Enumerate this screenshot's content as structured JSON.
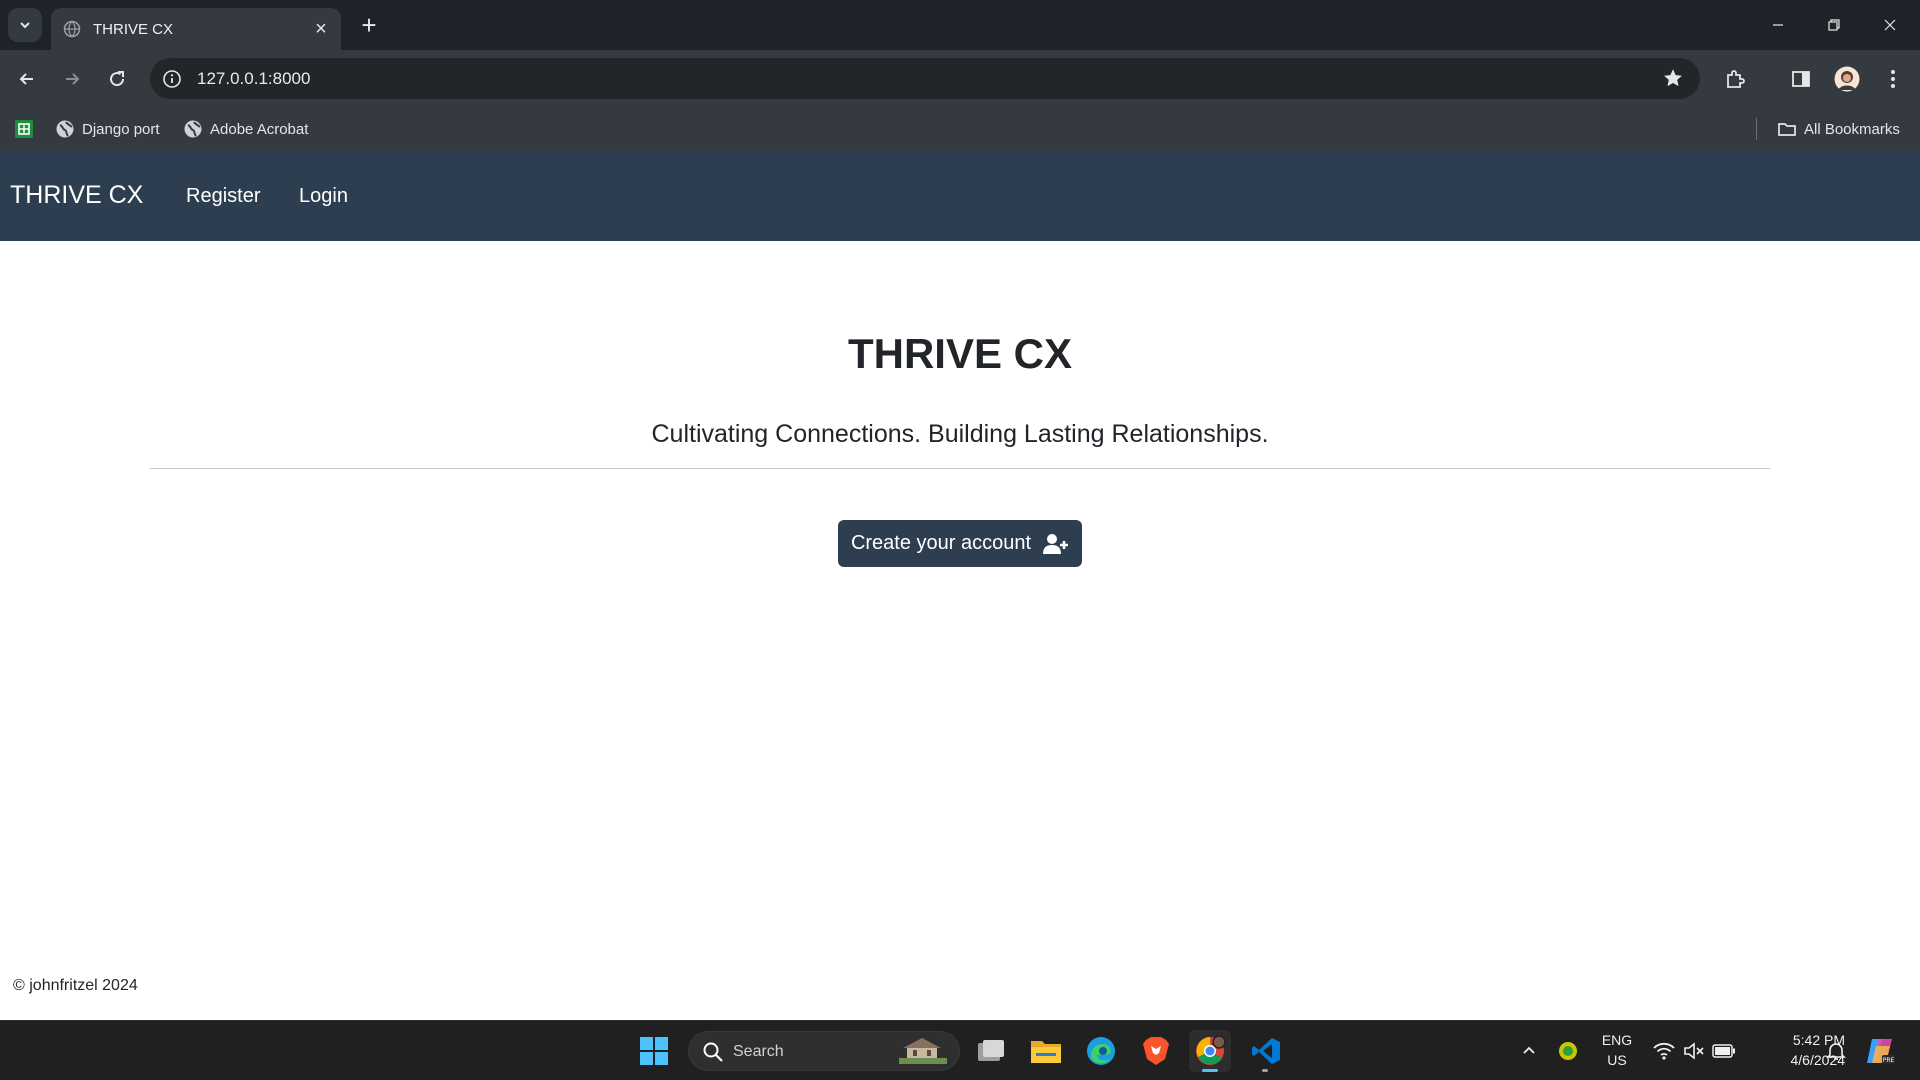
{
  "browser": {
    "tab_title": "THRIVE CX",
    "url": "127.0.0.1:8000",
    "bookmarks": [
      {
        "label": "Django port",
        "icon": "globe-icon"
      },
      {
        "label": "Adobe Acrobat",
        "icon": "globe-icon"
      }
    ],
    "all_bookmarks_label": "All Bookmarks"
  },
  "site": {
    "brand": "THRIVE CX",
    "nav": {
      "register": "Register",
      "login": "Login"
    },
    "hero": {
      "title": "THRIVE CX",
      "tagline": "Cultivating Connections. Building Lasting Relationships.",
      "cta_label": "Create your account",
      "cta_icon": "user-plus-icon"
    },
    "footer": "© johnfritzel 2024",
    "colors": {
      "navbar": "#2c3e50",
      "button": "#2c3e50"
    }
  },
  "taskbar": {
    "search_placeholder": "Search",
    "language": {
      "line1": "ENG",
      "line2": "US"
    },
    "clock": {
      "time": "5:42 PM",
      "date": "4/6/2024"
    }
  }
}
